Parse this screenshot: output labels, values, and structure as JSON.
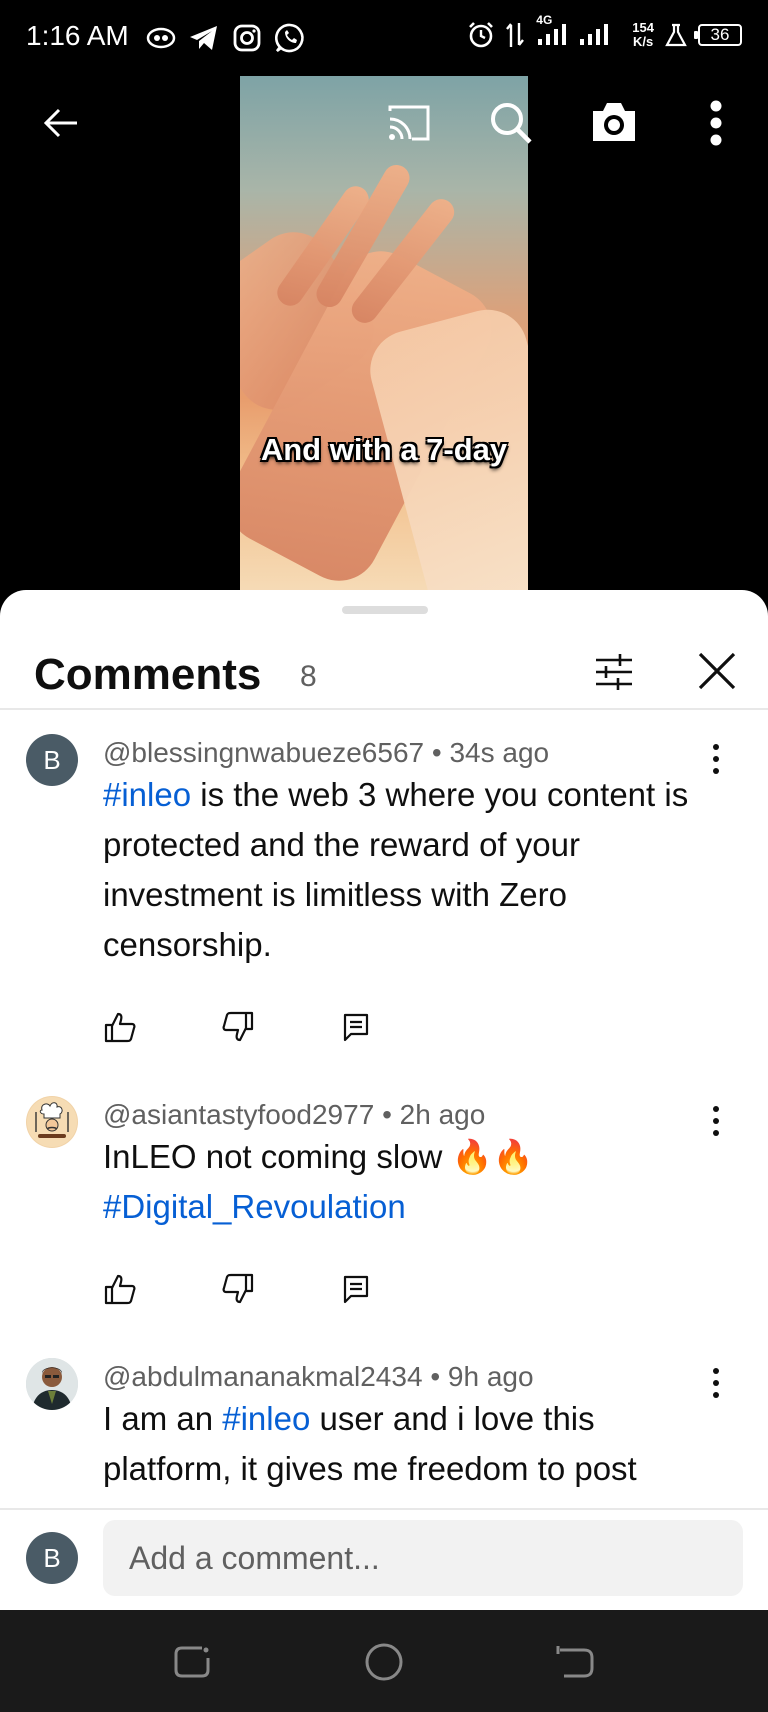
{
  "status_bar": {
    "time": "1:16 AM",
    "network": "4G",
    "speed_value": "154",
    "speed_unit": "K/s",
    "battery": "36"
  },
  "video": {
    "caption": "And with a 7-day"
  },
  "comments_panel": {
    "title": "Comments",
    "count": "8",
    "comments": [
      {
        "avatar_letter": "B",
        "author": "@blessingnwabueze6567",
        "time": "34s ago",
        "hashtag": "#inleo",
        "text": " is the web 3  where you content is protected and the reward of your investment is limitless with Zero censorship."
      },
      {
        "author": "@asiantastyfood2977",
        "time": "2h ago",
        "text": "InLEO not coming slow 🔥🔥",
        "hashtag": "#Digital_Revoulation"
      },
      {
        "author": "@abdulmananakmal2434",
        "time": "9h ago",
        "text_before": "I am an ",
        "hashtag": "#inleo",
        "text_after": " user and i love this platform, it gives me freedom to post"
      }
    ],
    "add_comment": {
      "avatar_letter": "B",
      "placeholder": "Add a comment..."
    }
  },
  "colors": {
    "hashtag": "#065fd4",
    "avatar": "#4a5b66",
    "text_secondary": "#606060"
  },
  "icons": [
    "back-arrow-icon",
    "cast-icon",
    "search-icon",
    "camera-icon",
    "more-vert-icon",
    "filter-icon",
    "close-icon",
    "like-icon",
    "dislike-icon",
    "reply-icon"
  ]
}
